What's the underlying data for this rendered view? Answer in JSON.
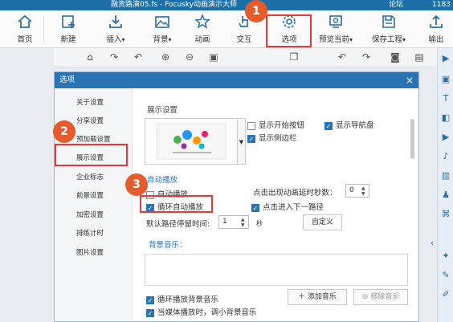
{
  "app": {
    "title": "融资路演05.fs - Focusky动画演示大师",
    "menu_right": [
      "论坛",
      "1183"
    ]
  },
  "toolbar": {
    "items": [
      {
        "label": "首页",
        "icon": "home-icon"
      },
      {
        "label": "新建",
        "icon": "new-icon"
      },
      {
        "label": "插入",
        "icon": "insert-icon",
        "dropdown": true
      },
      {
        "label": "背景",
        "icon": "background-icon",
        "dropdown": true
      },
      {
        "label": "动画",
        "icon": "animation-icon"
      },
      {
        "label": "交互",
        "icon": "interaction-icon"
      },
      {
        "label": "选项",
        "icon": "gear-icon"
      },
      {
        "label": "预览当前",
        "icon": "preview-icon",
        "dropdown": true
      },
      {
        "label": "保存工程",
        "icon": "save-icon",
        "dropdown": true
      },
      {
        "label": "输出",
        "icon": "export-icon"
      }
    ]
  },
  "annotations": {
    "b1": "1",
    "b2": "2",
    "b3": "3"
  },
  "dialog": {
    "title": "选项",
    "close": "×",
    "sidebar": [
      "关于设置",
      "分享设置",
      "预加载设置",
      "展示设置",
      "企业标志",
      "前景设置",
      "加密设置",
      "排练计时",
      "图片设置"
    ],
    "display_heading": "展示设置",
    "show_start_button": "显示开始按钮",
    "show_nav_bar": "显示导航盘",
    "show_sidebar": "显示侧边栏",
    "autoplay_heading": "自动播放",
    "autoplay": "自动播放",
    "loop_autoplay": "循环自动播放",
    "delay_label": "点击出现动画延时秒数：",
    "delay_value": "0",
    "click_next": "点击进入下一路径",
    "default_stay_label": "默认路径停留时间:",
    "default_stay_value": "1",
    "seconds": "秒",
    "custom": "自定义",
    "bg_music_heading": "背景音乐：",
    "loop_bg_music": "循环播放背景音乐",
    "lower_volume": "当媒体播放时，调小背景音乐",
    "add_music": "添加音乐",
    "remove_music": "移除音乐"
  },
  "colors": {
    "accent": "#2a74b4",
    "highlight": "#e53935",
    "badge": "#e55b2c"
  }
}
